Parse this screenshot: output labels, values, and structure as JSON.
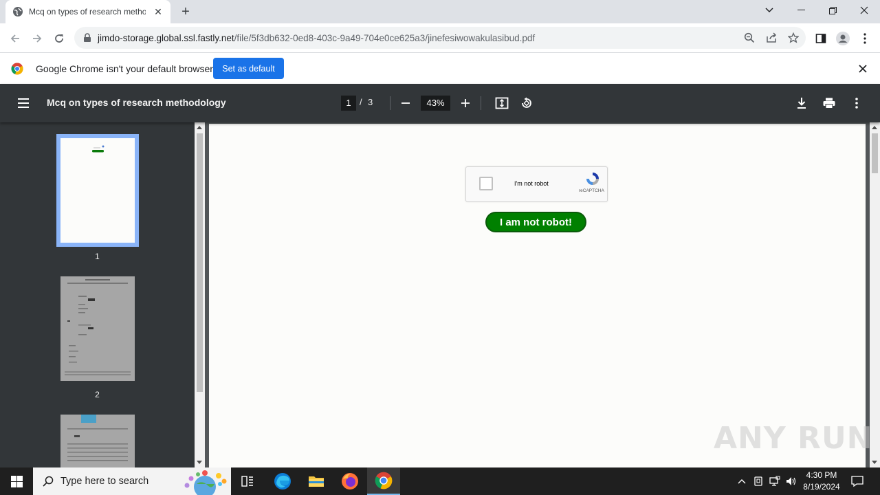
{
  "browser": {
    "tab_title": "Mcq on types of research metho",
    "url_host": "jimdo-storage.global.ssl.fastly.net",
    "url_path": "/file/5f3db632-0ed8-403c-9a49-704e0ce625a3/jinefesiwowakulasibud.pdf"
  },
  "infobar": {
    "message": "Google Chrome isn't your default browser",
    "button_label": "Set as default"
  },
  "pdf_toolbar": {
    "doc_title": "Mcq on types of research methodology",
    "current_page": "1",
    "page_separator": "/",
    "page_count": "3",
    "zoom": "43%"
  },
  "sidebar": {
    "thumb_labels": [
      "1",
      "2"
    ]
  },
  "page": {
    "captcha_label": "I'm not robot",
    "captcha_brand": "reCAPTCHA",
    "robot_button": "I am not robot!"
  },
  "watermark": "ANY RUN",
  "taskbar": {
    "search_placeholder": "Type here to search",
    "time": "4:30 PM",
    "date": "8/19/2024"
  },
  "colors": {
    "accent_blue": "#1a73e8",
    "pdf_toolbar": "#323639",
    "robot_green": "#008000"
  }
}
